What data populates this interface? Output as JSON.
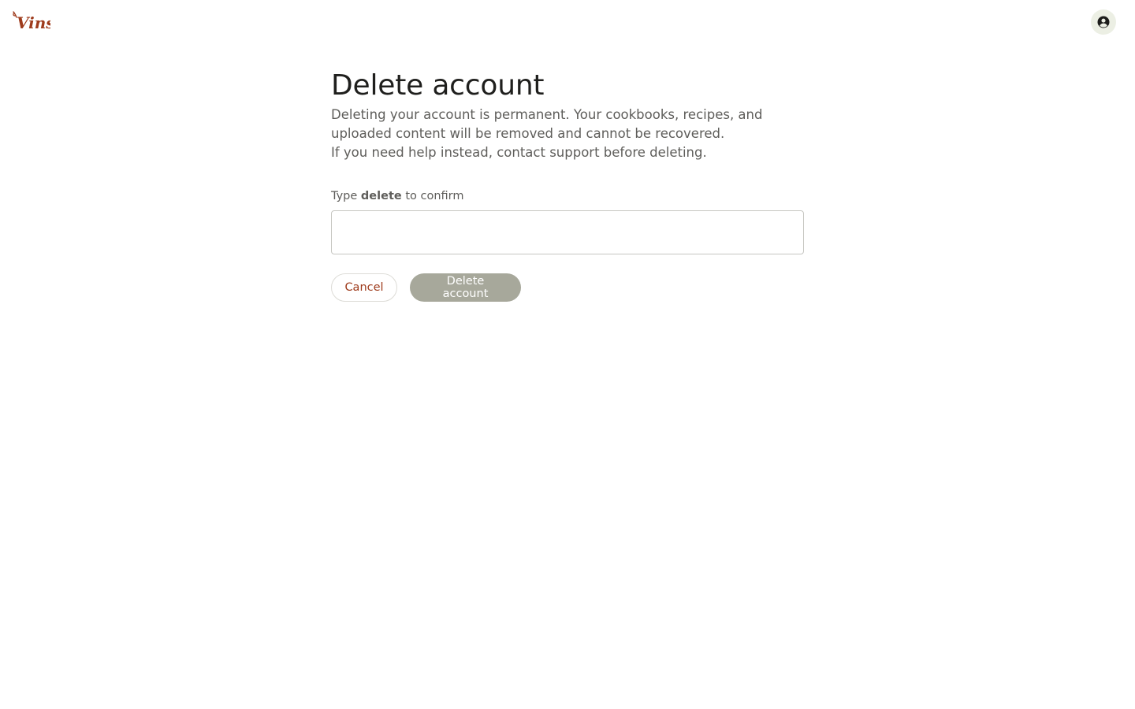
{
  "brand": {
    "logo_text": "Vinst",
    "logo_color": "#9e3b1c"
  },
  "header": {
    "account_icon": "account-circle-icon"
  },
  "page": {
    "title": "Delete account",
    "paragraph_1": "Deleting your account is permanent. Your cookbooks, recipes, and uploaded content will be removed and cannot be recovered.",
    "paragraph_2": "If you need help instead, contact support before deleting."
  },
  "confirm": {
    "label_prefix": "Type",
    "label_keyword": "delete",
    "label_suffix": "to confirm",
    "input_value": "",
    "input_placeholder": ""
  },
  "actions": {
    "cancel_label": "Cancel",
    "delete_label": "Delete account",
    "delete_disabled": true
  },
  "colors": {
    "accent": "#9e3b1c",
    "disabled_button": "#a7a89b",
    "avatar_bg": "#ecefe4"
  }
}
